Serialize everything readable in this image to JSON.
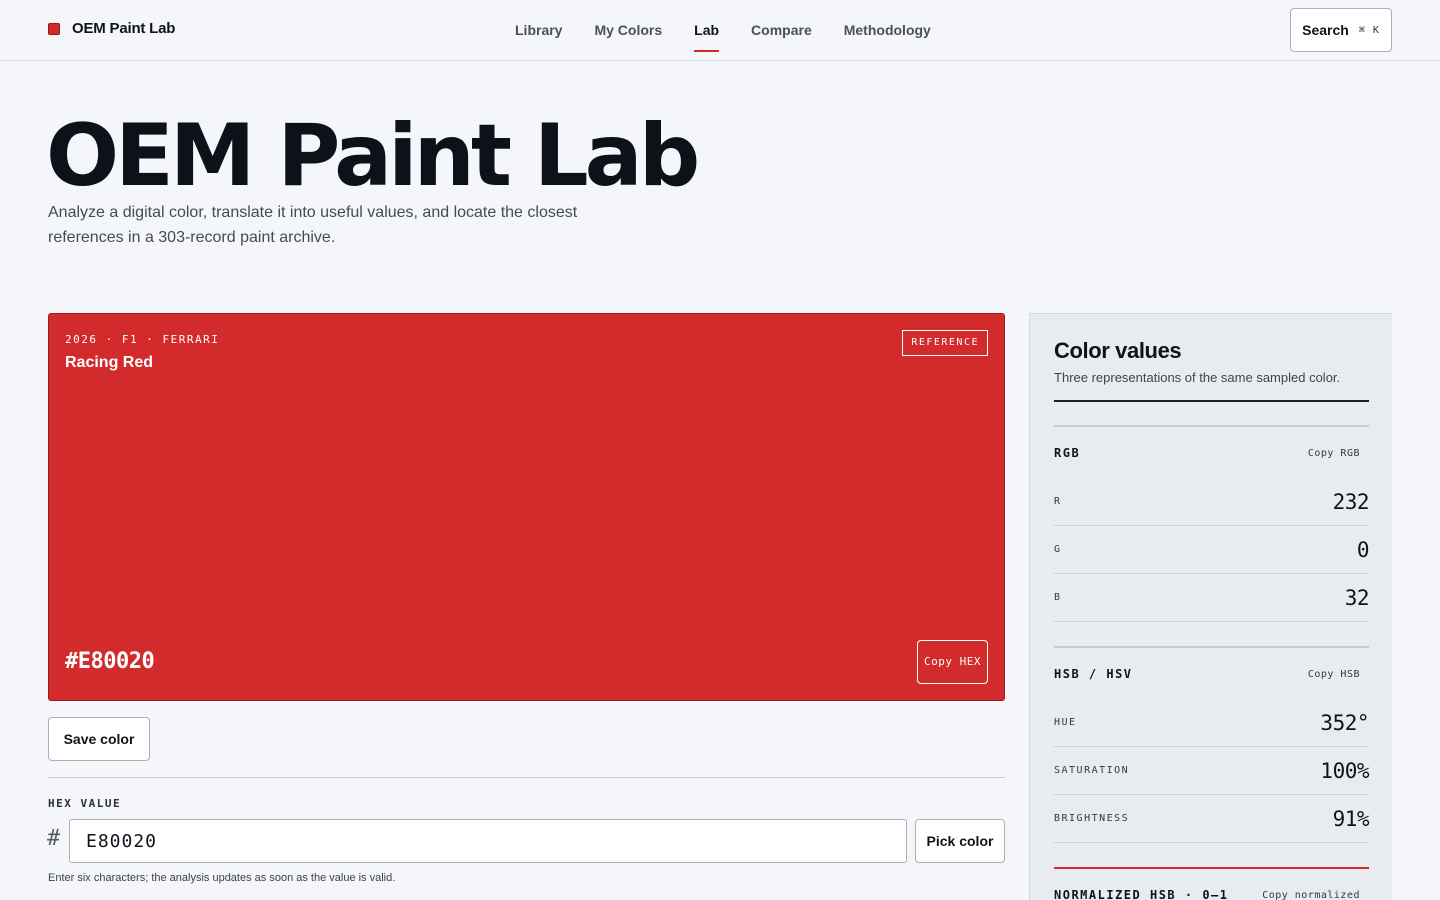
{
  "brand": {
    "name": "OEM Paint Lab",
    "accent": "#d32a2c"
  },
  "nav": {
    "items": [
      {
        "label": "Library"
      },
      {
        "label": "My Colors"
      },
      {
        "label": "Lab",
        "active": true
      },
      {
        "label": "Compare"
      },
      {
        "label": "Methodology"
      }
    ],
    "search_label": "Search",
    "search_shortcut": "⌘ K"
  },
  "hero": {
    "title": "OEM Paint Lab",
    "subtitle": "Analyze a digital color, translate it into useful values, and locate the closest references in a 303-record paint archive."
  },
  "swatch": {
    "meta": "2026 · F1 · FERRARI",
    "name": "Racing Red",
    "badge": "REFERENCE",
    "hex_display": "#E80020",
    "copy_hex_label": "Copy HEX",
    "fill_color": "#d32a2c"
  },
  "actions": {
    "save_label": "Save color",
    "pick_label": "Pick color"
  },
  "hex_field": {
    "label": "HEX VALUE",
    "prefix": "#",
    "value": "E80020",
    "hint": "Enter six characters; the analysis updates as soon as the value is valid."
  },
  "panel": {
    "title": "Color values",
    "subtitle": "Three representations of the same sampled color.",
    "rgb": {
      "name": "RGB",
      "copy_label": "Copy RGB",
      "rows": [
        {
          "label": "R",
          "value": "232"
        },
        {
          "label": "G",
          "value": "0"
        },
        {
          "label": "B",
          "value": "32"
        }
      ]
    },
    "hsb": {
      "name": "HSB / HSV",
      "copy_label": "Copy HSB",
      "rows": [
        {
          "label": "HUE",
          "value": "352°"
        },
        {
          "label": "SATURATION",
          "value": "100%"
        },
        {
          "label": "BRIGHTNESS",
          "value": "91%"
        }
      ]
    },
    "normalized": {
      "name": "NORMALIZED HSB · 0–1",
      "copy_label": "Copy normalized"
    }
  }
}
